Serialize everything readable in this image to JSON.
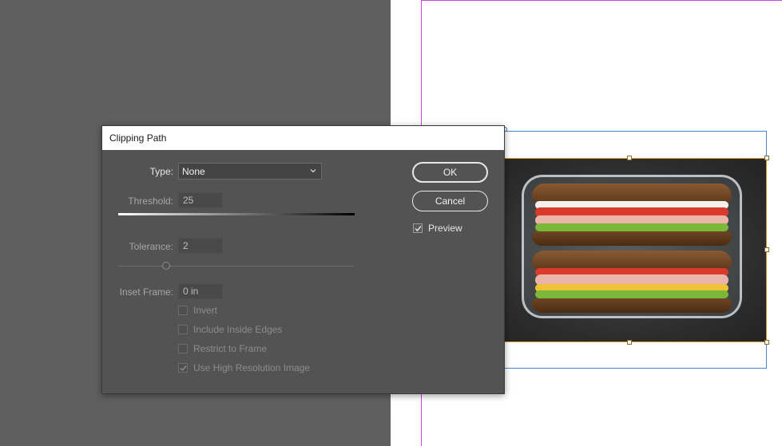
{
  "dialog": {
    "title": "Clipping Path",
    "type_label": "Type:",
    "type_value": "None",
    "threshold_label": "Threshold:",
    "threshold_value": "25",
    "tolerance_label": "Tolerance:",
    "tolerance_value": "2",
    "inset_label": "Inset Frame:",
    "inset_value": "0 in",
    "ok_label": "OK",
    "cancel_label": "Cancel",
    "preview_label": "Preview",
    "preview_checked": true,
    "options": [
      {
        "label": "Invert",
        "checked": false
      },
      {
        "label": "Include Inside Edges",
        "checked": false
      },
      {
        "label": "Restrict to Frame",
        "checked": false
      },
      {
        "label": "Use High Resolution Image",
        "checked": true
      }
    ]
  },
  "colors": {
    "margin_guide": "#c24bd6",
    "frame_outline": "#4a86c8",
    "image_frame": "#d49a2a",
    "dialog_bg": "#535353"
  },
  "icons": [
    "chevron-down-icon",
    "checkmark-icon"
  ]
}
